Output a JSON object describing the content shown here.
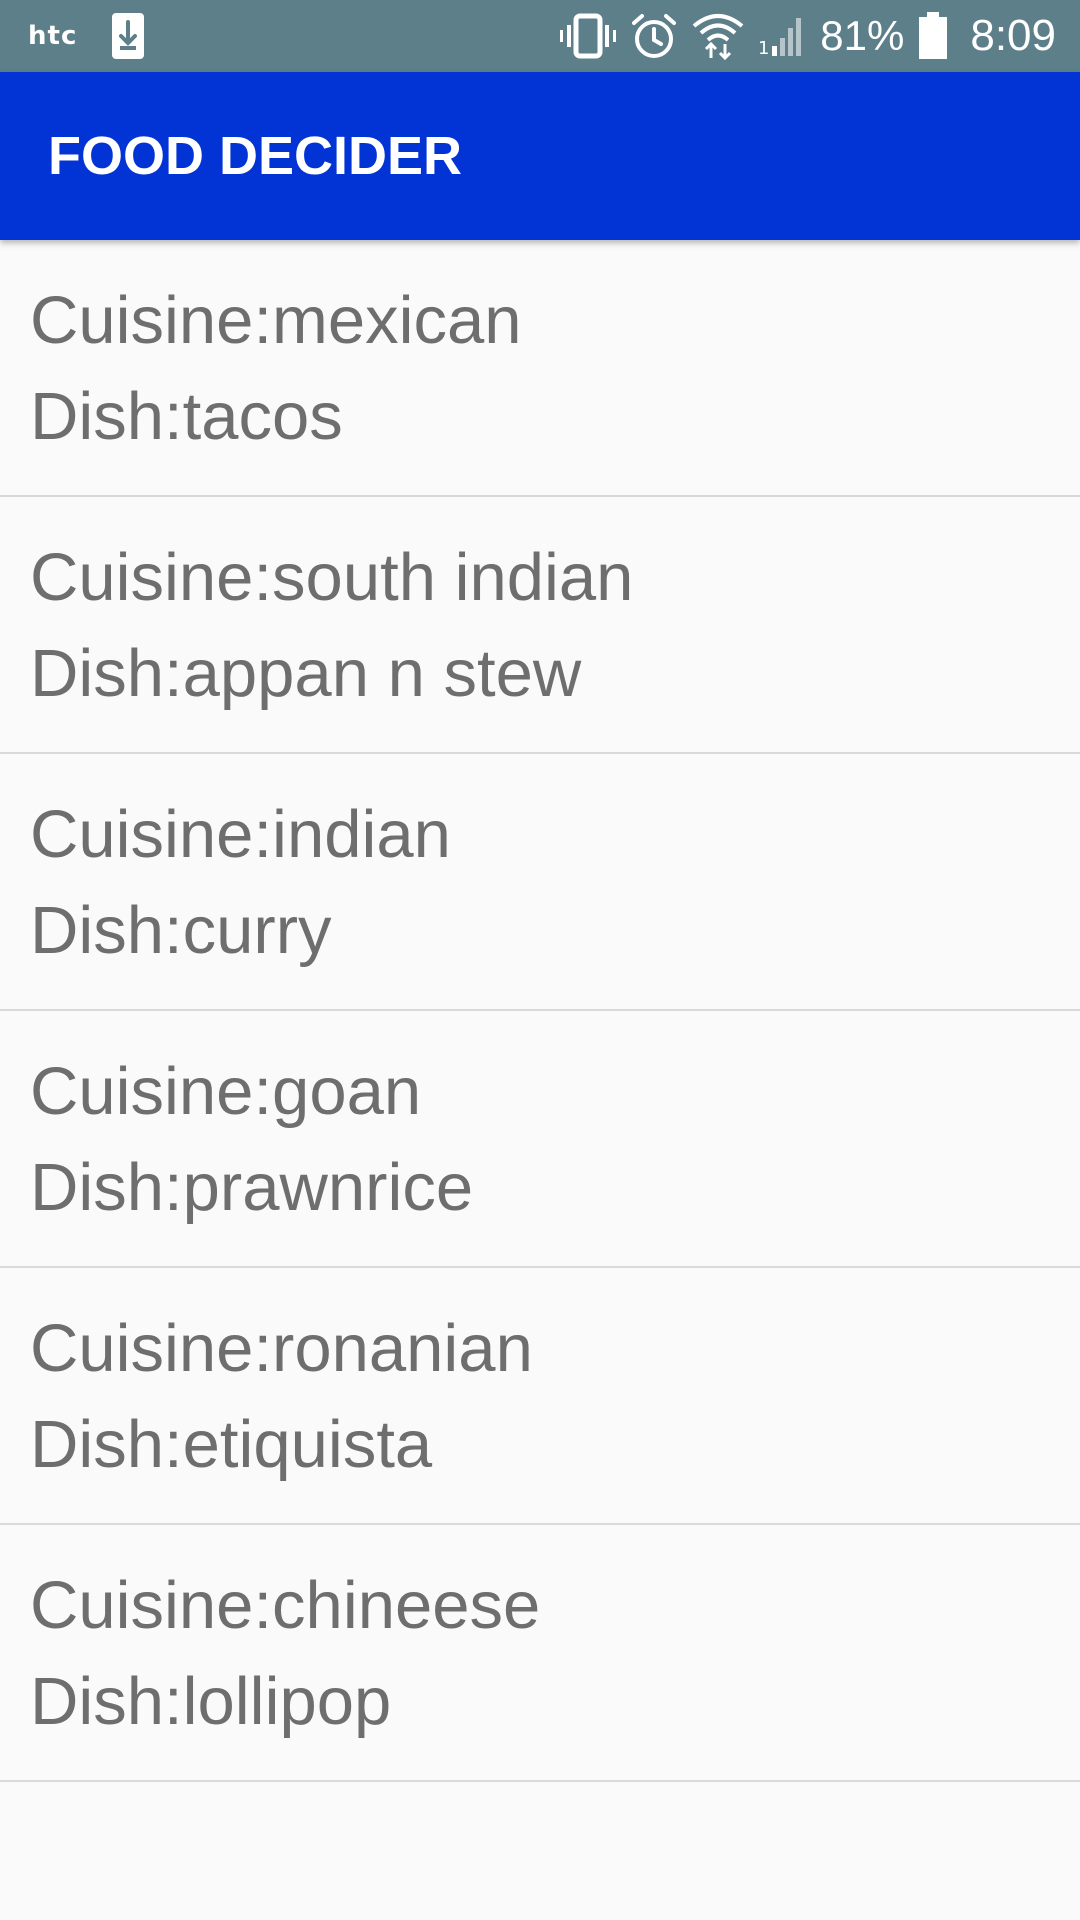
{
  "status_bar": {
    "brand": "htc",
    "battery_percent": "81%",
    "time": "8:09",
    "icons": [
      "download-icon",
      "vibrate-icon",
      "alarm-icon",
      "wifi-icon",
      "signal-icon",
      "battery-icon"
    ],
    "background_color": "#5c7f8a"
  },
  "app_bar": {
    "title": "FOOD DECIDER",
    "background_color": "#0233d5"
  },
  "list": {
    "items": [
      {
        "cuisine": "Cuisine:mexican",
        "dish": "Dish:tacos"
      },
      {
        "cuisine": "Cuisine:south indian",
        "dish": "Dish:appan n stew"
      },
      {
        "cuisine": "Cuisine:indian",
        "dish": "Dish:curry"
      },
      {
        "cuisine": "Cuisine:goan",
        "dish": "Dish:prawnrice"
      },
      {
        "cuisine": "Cuisine:ronanian",
        "dish": "Dish:etiquista"
      },
      {
        "cuisine": "Cuisine:chineese",
        "dish": "Dish:lollipop"
      }
    ]
  }
}
